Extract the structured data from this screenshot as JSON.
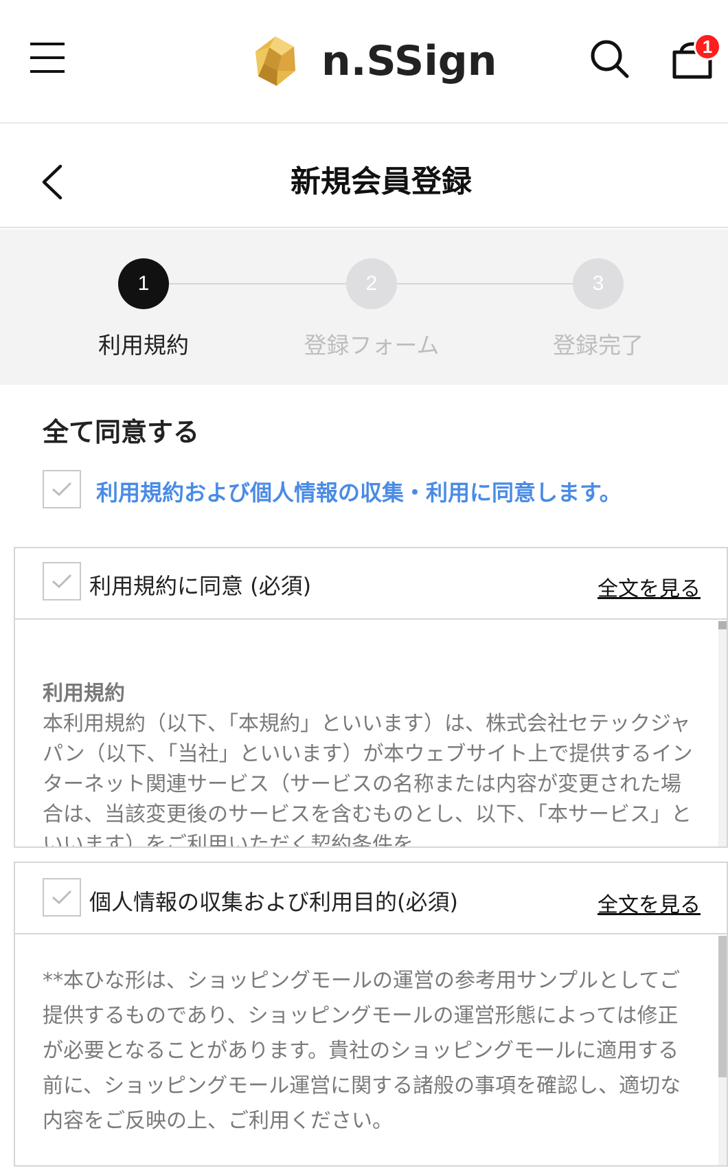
{
  "header": {
    "brand": "n.SSign",
    "cart_count": "1"
  },
  "titlebar": {
    "title": "新規会員登録"
  },
  "steps": [
    {
      "number": "1",
      "label": "利用規約",
      "active": true
    },
    {
      "number": "2",
      "label": "登録フォーム",
      "active": false
    },
    {
      "number": "3",
      "label": "登録完了",
      "active": false
    }
  ],
  "agreement": {
    "heading": "全て同意する",
    "agree_all_label": "利用規約および個人情報の収集・利用に同意します。",
    "terms": [
      {
        "label": "利用規約に同意 (必須)",
        "link": "全文を見る",
        "body_title": "利用規約",
        "body_text": "本利用規約（以下、「本規約」といいます）は、株式会社セテックジャパン（以下、「当社」といいます）が本ウェブサイト上で提供するインターネット関連サービス（サービスの名称または内容が変更された場合は、当該変更後のサービスを含むものとし、以下、「本サービス」といいます）をご利用いただく契約条件を"
      },
      {
        "label": "個人情報の収集および利用目的(必須)",
        "link": "全文を見る",
        "body_text": "**本ひな形は、ショッピングモールの運営の参考用サンプルとしてご提供するものであり、ショッピングモールの運営形態によっては修正が必要となることがあります。貴社のショッピングモールに適用する前に、ショッピングモール運営に関する諸般の事項を確認し、適切な内容をご反映の上、ご利用ください。"
      }
    ]
  },
  "colors": {
    "accent_blue": "#4a8be5",
    "badge_red": "#ff1e1e",
    "step_active": "#111111",
    "step_inactive": "#dedee0"
  },
  "icons": {
    "menu": "hamburger-menu-icon",
    "search": "search-icon",
    "cart": "cart-icon",
    "back": "chevron-left-icon",
    "check": "checkmark-icon",
    "logo": "hexagon-logo-icon"
  }
}
